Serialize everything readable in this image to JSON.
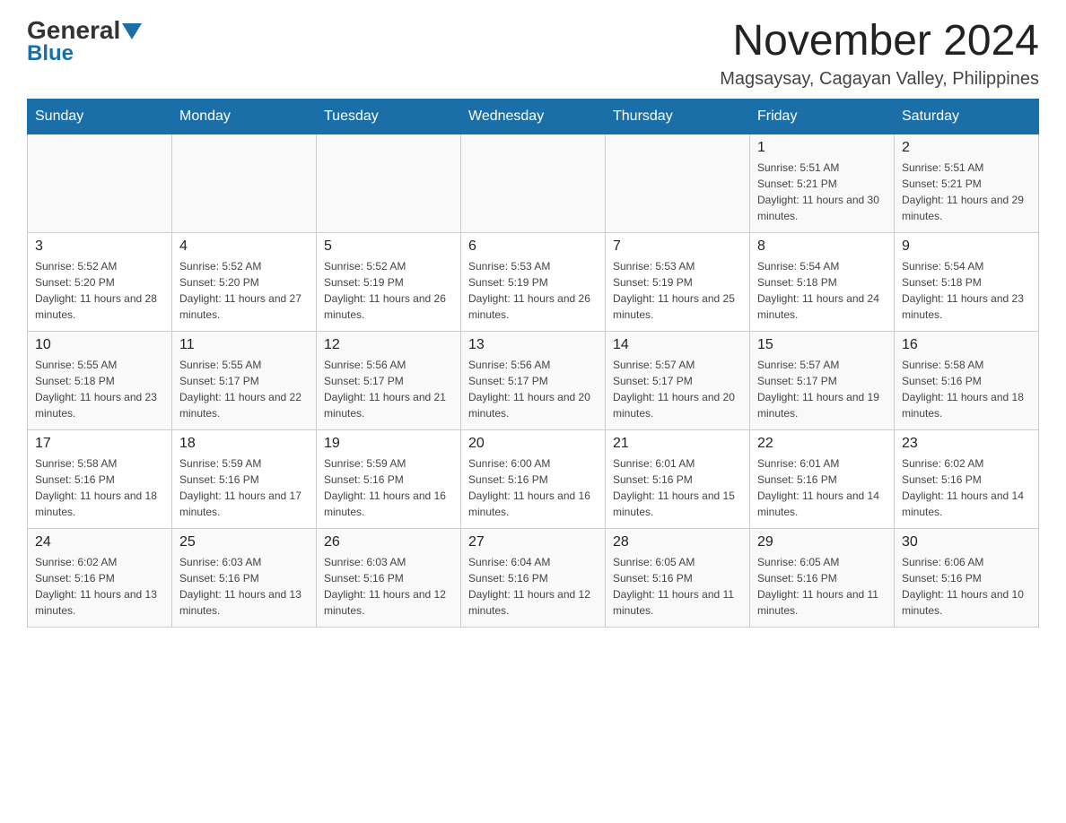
{
  "header": {
    "logo_general": "General",
    "logo_blue": "Blue",
    "month_title": "November 2024",
    "location": "Magsaysay, Cagayan Valley, Philippines"
  },
  "days_of_week": [
    "Sunday",
    "Monday",
    "Tuesday",
    "Wednesday",
    "Thursday",
    "Friday",
    "Saturday"
  ],
  "weeks": [
    {
      "days": [
        {
          "number": "",
          "info": ""
        },
        {
          "number": "",
          "info": ""
        },
        {
          "number": "",
          "info": ""
        },
        {
          "number": "",
          "info": ""
        },
        {
          "number": "",
          "info": ""
        },
        {
          "number": "1",
          "info": "Sunrise: 5:51 AM\nSunset: 5:21 PM\nDaylight: 11 hours and 30 minutes."
        },
        {
          "number": "2",
          "info": "Sunrise: 5:51 AM\nSunset: 5:21 PM\nDaylight: 11 hours and 29 minutes."
        }
      ]
    },
    {
      "days": [
        {
          "number": "3",
          "info": "Sunrise: 5:52 AM\nSunset: 5:20 PM\nDaylight: 11 hours and 28 minutes."
        },
        {
          "number": "4",
          "info": "Sunrise: 5:52 AM\nSunset: 5:20 PM\nDaylight: 11 hours and 27 minutes."
        },
        {
          "number": "5",
          "info": "Sunrise: 5:52 AM\nSunset: 5:19 PM\nDaylight: 11 hours and 26 minutes."
        },
        {
          "number": "6",
          "info": "Sunrise: 5:53 AM\nSunset: 5:19 PM\nDaylight: 11 hours and 26 minutes."
        },
        {
          "number": "7",
          "info": "Sunrise: 5:53 AM\nSunset: 5:19 PM\nDaylight: 11 hours and 25 minutes."
        },
        {
          "number": "8",
          "info": "Sunrise: 5:54 AM\nSunset: 5:18 PM\nDaylight: 11 hours and 24 minutes."
        },
        {
          "number": "9",
          "info": "Sunrise: 5:54 AM\nSunset: 5:18 PM\nDaylight: 11 hours and 23 minutes."
        }
      ]
    },
    {
      "days": [
        {
          "number": "10",
          "info": "Sunrise: 5:55 AM\nSunset: 5:18 PM\nDaylight: 11 hours and 23 minutes."
        },
        {
          "number": "11",
          "info": "Sunrise: 5:55 AM\nSunset: 5:17 PM\nDaylight: 11 hours and 22 minutes."
        },
        {
          "number": "12",
          "info": "Sunrise: 5:56 AM\nSunset: 5:17 PM\nDaylight: 11 hours and 21 minutes."
        },
        {
          "number": "13",
          "info": "Sunrise: 5:56 AM\nSunset: 5:17 PM\nDaylight: 11 hours and 20 minutes."
        },
        {
          "number": "14",
          "info": "Sunrise: 5:57 AM\nSunset: 5:17 PM\nDaylight: 11 hours and 20 minutes."
        },
        {
          "number": "15",
          "info": "Sunrise: 5:57 AM\nSunset: 5:17 PM\nDaylight: 11 hours and 19 minutes."
        },
        {
          "number": "16",
          "info": "Sunrise: 5:58 AM\nSunset: 5:16 PM\nDaylight: 11 hours and 18 minutes."
        }
      ]
    },
    {
      "days": [
        {
          "number": "17",
          "info": "Sunrise: 5:58 AM\nSunset: 5:16 PM\nDaylight: 11 hours and 18 minutes."
        },
        {
          "number": "18",
          "info": "Sunrise: 5:59 AM\nSunset: 5:16 PM\nDaylight: 11 hours and 17 minutes."
        },
        {
          "number": "19",
          "info": "Sunrise: 5:59 AM\nSunset: 5:16 PM\nDaylight: 11 hours and 16 minutes."
        },
        {
          "number": "20",
          "info": "Sunrise: 6:00 AM\nSunset: 5:16 PM\nDaylight: 11 hours and 16 minutes."
        },
        {
          "number": "21",
          "info": "Sunrise: 6:01 AM\nSunset: 5:16 PM\nDaylight: 11 hours and 15 minutes."
        },
        {
          "number": "22",
          "info": "Sunrise: 6:01 AM\nSunset: 5:16 PM\nDaylight: 11 hours and 14 minutes."
        },
        {
          "number": "23",
          "info": "Sunrise: 6:02 AM\nSunset: 5:16 PM\nDaylight: 11 hours and 14 minutes."
        }
      ]
    },
    {
      "days": [
        {
          "number": "24",
          "info": "Sunrise: 6:02 AM\nSunset: 5:16 PM\nDaylight: 11 hours and 13 minutes."
        },
        {
          "number": "25",
          "info": "Sunrise: 6:03 AM\nSunset: 5:16 PM\nDaylight: 11 hours and 13 minutes."
        },
        {
          "number": "26",
          "info": "Sunrise: 6:03 AM\nSunset: 5:16 PM\nDaylight: 11 hours and 12 minutes."
        },
        {
          "number": "27",
          "info": "Sunrise: 6:04 AM\nSunset: 5:16 PM\nDaylight: 11 hours and 12 minutes."
        },
        {
          "number": "28",
          "info": "Sunrise: 6:05 AM\nSunset: 5:16 PM\nDaylight: 11 hours and 11 minutes."
        },
        {
          "number": "29",
          "info": "Sunrise: 6:05 AM\nSunset: 5:16 PM\nDaylight: 11 hours and 11 minutes."
        },
        {
          "number": "30",
          "info": "Sunrise: 6:06 AM\nSunset: 5:16 PM\nDaylight: 11 hours and 10 minutes."
        }
      ]
    }
  ]
}
